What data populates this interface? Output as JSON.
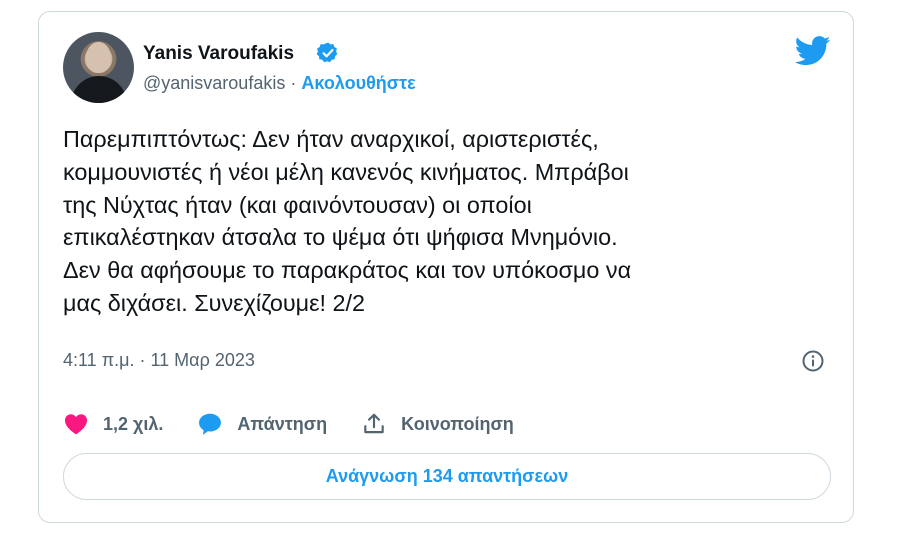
{
  "author": {
    "name": "Yanis Varoufakis",
    "handle": "@yanisvaroufakis",
    "separator": "·",
    "follow_label": "Ακολουθήστε"
  },
  "tweet": {
    "text": "Παρεμπιπτόντως: Δεν ήταν αναρχικοί, αριστεριστές,\nκομμουνιστές ή νέοι μέλη κανενός κινήματος. Μπράβοι\nτης Νύχτας ήταν (και φαινόντουσαν) οι οποίοι\nεπικαλέστηκαν άτσαλα το ψέμα ότι ψήφισα Μνημόνιο.\nΔεν θα αφήσουμε το παρακράτος και τον υπόκοσμο να\nμας διχάσει. Συνεχίζουμε! 2/2",
    "timestamp": "4:11 π.μ. · 11 Μαρ 2023"
  },
  "actions": {
    "likes_count": "1,2 χιλ.",
    "reply_label": "Απάντηση",
    "share_label": "Κοινοποίηση"
  },
  "read_replies_label": "Ανάγνωση 134 απαντήσεων",
  "icons": {
    "verified": "verified-badge-icon",
    "logo": "twitter-bird-icon",
    "info": "info-icon",
    "like": "heart-icon",
    "reply": "speech-bubble-icon",
    "share": "share-upload-icon"
  },
  "colors": {
    "accent": "#1d9bf0",
    "like": "#f91880",
    "text": "#0f1419",
    "muted": "#536471",
    "border": "#cfd9de"
  }
}
